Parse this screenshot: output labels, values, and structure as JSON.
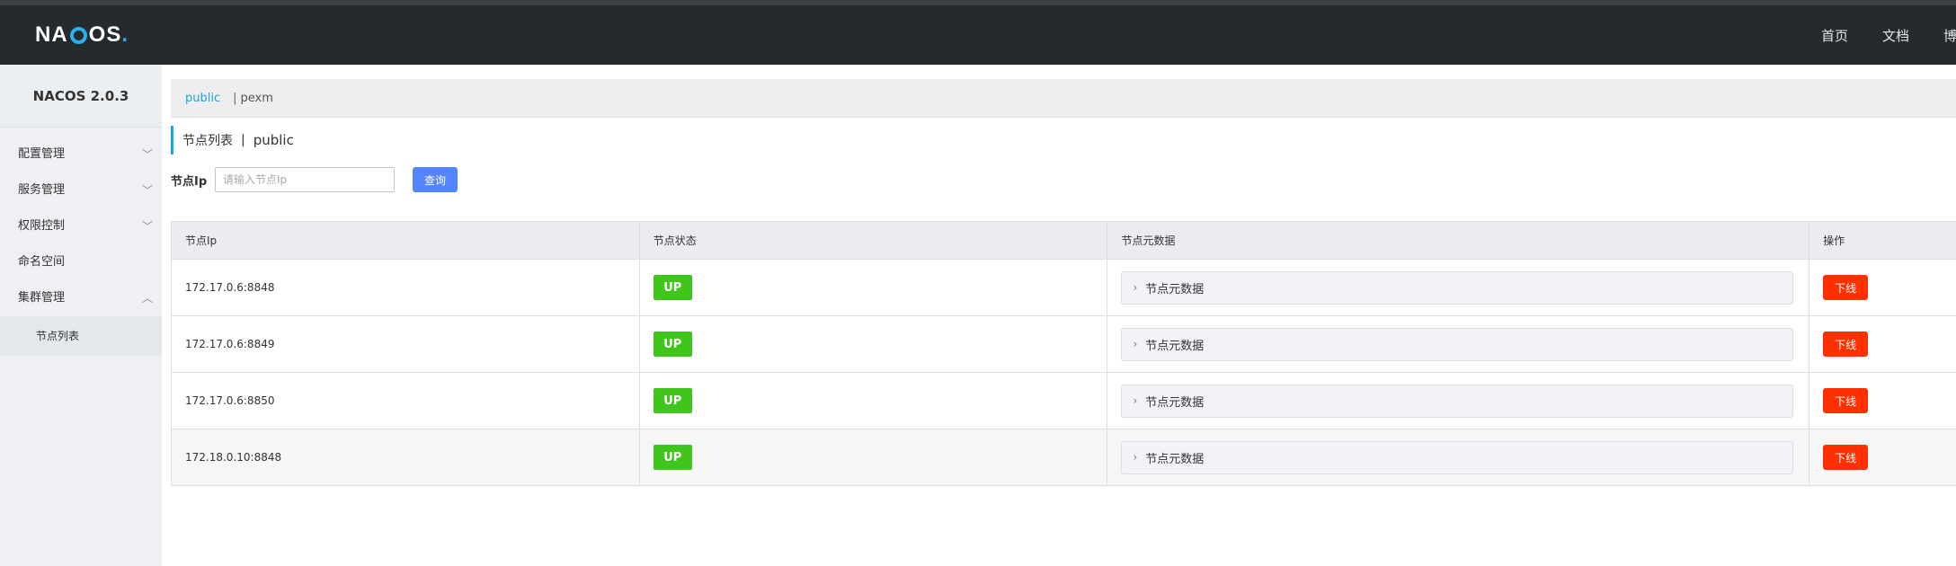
{
  "header": {
    "logo_text": "NACOS",
    "nav": [
      "首页",
      "文档",
      "博"
    ]
  },
  "sidebar": {
    "version": "NACOS 2.0.3",
    "items": [
      {
        "label": "配置管理",
        "chevron": "chevron-down"
      },
      {
        "label": "服务管理",
        "chevron": "chevron-down"
      },
      {
        "label": "权限控制",
        "chevron": "chevron-down"
      },
      {
        "label": "命名空间",
        "chevron": ""
      },
      {
        "label": "集群管理",
        "chevron": "chevron-up"
      }
    ],
    "sub_items": [
      "节点列表"
    ]
  },
  "namespaces": {
    "active": "public",
    "separator": "|",
    "other": "pexm"
  },
  "page": {
    "title": "节点列表",
    "separator": "|",
    "namespace": "public"
  },
  "search": {
    "label": "节点Ip",
    "placeholder": "请输入节点Ip",
    "button": "查询"
  },
  "table": {
    "headers": [
      "节点Ip",
      "节点状态",
      "节点元数据",
      "操作"
    ],
    "rows": [
      {
        "ip": "172.17.0.6:8848",
        "status": "UP",
        "meta": "节点元数据",
        "action": "下线"
      },
      {
        "ip": "172.17.0.6:8849",
        "status": "UP",
        "meta": "节点元数据",
        "action": "下线"
      },
      {
        "ip": "172.17.0.6:8850",
        "status": "UP",
        "meta": "节点元数据",
        "action": "下线"
      },
      {
        "ip": "172.18.0.10:8848",
        "status": "UP",
        "meta": "节点元数据",
        "action": "下线"
      }
    ]
  },
  "colors": {
    "header_bg": "#252a2f",
    "accent": "#1ba2e0",
    "primary_button": "#5584ff",
    "status_up": "#3fc51b",
    "danger_button": "#ff3000"
  }
}
